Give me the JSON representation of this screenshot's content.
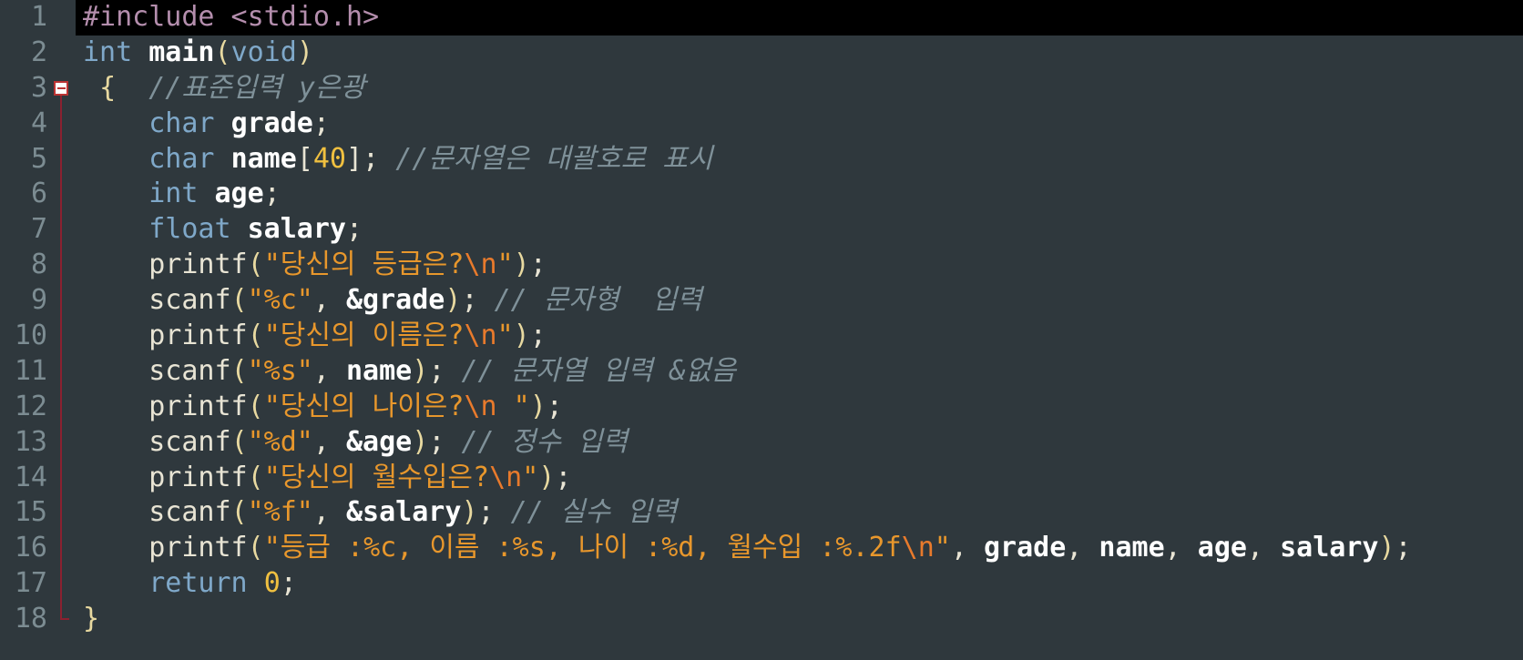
{
  "editor": {
    "language": "c",
    "theme": "dark",
    "background": "#2f383d",
    "gutter_background": "#2f383d",
    "current_line_background": "#000000",
    "line_number_color": "#7c8c92",
    "fold_marker_color": "#b33333",
    "total_lines": 18,
    "first_visible_line": 1,
    "fold_marker_line": 3,
    "fold_end_line": 18,
    "colors": {
      "preprocessor": "#b48ead",
      "keyword": "#7fa8c9",
      "identifier": "#ffffff",
      "string": "#e8972c",
      "escape": "#e87a2c",
      "number": "#f0c040",
      "comment": "#7f9199",
      "punctuation": "#e8e4d4",
      "brace": "#e8d9a0"
    }
  },
  "lines": [
    {
      "number": "1",
      "current": true,
      "tokens": [
        {
          "cls": "t-pre",
          "text": "#include <stdio.h>"
        }
      ]
    },
    {
      "number": "2",
      "current": false,
      "tokens": [
        {
          "cls": "t-key",
          "text": "int"
        },
        {
          "cls": "t-plain",
          "text": " "
        },
        {
          "cls": "t-ident",
          "text": "main"
        },
        {
          "cls": "t-paren",
          "text": "("
        },
        {
          "cls": "t-key",
          "text": "void"
        },
        {
          "cls": "t-paren",
          "text": ")"
        }
      ]
    },
    {
      "number": "3",
      "current": false,
      "tokens": [
        {
          "cls": "t-plain",
          "text": " "
        },
        {
          "cls": "t-brace",
          "text": "{"
        },
        {
          "cls": "t-plain",
          "text": "  "
        },
        {
          "cls": "t-com",
          "text": "//표준입력 y은광"
        }
      ]
    },
    {
      "number": "4",
      "current": false,
      "tokens": [
        {
          "cls": "t-plain",
          "text": "    "
        },
        {
          "cls": "t-key",
          "text": "char"
        },
        {
          "cls": "t-plain",
          "text": " "
        },
        {
          "cls": "t-ident",
          "text": "grade"
        },
        {
          "cls": "t-punc",
          "text": ";"
        }
      ]
    },
    {
      "number": "5",
      "current": false,
      "tokens": [
        {
          "cls": "t-plain",
          "text": "    "
        },
        {
          "cls": "t-key",
          "text": "char"
        },
        {
          "cls": "t-plain",
          "text": " "
        },
        {
          "cls": "t-ident",
          "text": "name"
        },
        {
          "cls": "t-punc",
          "text": "["
        },
        {
          "cls": "t-num",
          "text": "40"
        },
        {
          "cls": "t-punc",
          "text": "];"
        },
        {
          "cls": "t-plain",
          "text": " "
        },
        {
          "cls": "t-com",
          "text": "//문자열은 대괄호로 표시"
        }
      ]
    },
    {
      "number": "6",
      "current": false,
      "tokens": [
        {
          "cls": "t-plain",
          "text": "    "
        },
        {
          "cls": "t-key",
          "text": "int"
        },
        {
          "cls": "t-plain",
          "text": " "
        },
        {
          "cls": "t-ident",
          "text": "age"
        },
        {
          "cls": "t-punc",
          "text": ";"
        }
      ]
    },
    {
      "number": "7",
      "current": false,
      "tokens": [
        {
          "cls": "t-plain",
          "text": "    "
        },
        {
          "cls": "t-key",
          "text": "float"
        },
        {
          "cls": "t-plain",
          "text": " "
        },
        {
          "cls": "t-ident",
          "text": "salary"
        },
        {
          "cls": "t-punc",
          "text": ";"
        }
      ]
    },
    {
      "number": "8",
      "current": false,
      "tokens": [
        {
          "cls": "t-plain",
          "text": "    "
        },
        {
          "cls": "t-fn",
          "text": "printf"
        },
        {
          "cls": "t-paren",
          "text": "("
        },
        {
          "cls": "t-str",
          "text": "\"당신의 등급은?"
        },
        {
          "cls": "t-esc",
          "text": "\\n"
        },
        {
          "cls": "t-str",
          "text": "\""
        },
        {
          "cls": "t-paren",
          "text": ")"
        },
        {
          "cls": "t-punc",
          "text": ";"
        }
      ]
    },
    {
      "number": "9",
      "current": false,
      "tokens": [
        {
          "cls": "t-plain",
          "text": "    "
        },
        {
          "cls": "t-fn",
          "text": "scanf"
        },
        {
          "cls": "t-paren",
          "text": "("
        },
        {
          "cls": "t-str",
          "text": "\"%c\""
        },
        {
          "cls": "t-punc",
          "text": ", "
        },
        {
          "cls": "t-ident",
          "text": "&grade"
        },
        {
          "cls": "t-paren",
          "text": ")"
        },
        {
          "cls": "t-punc",
          "text": ";"
        },
        {
          "cls": "t-plain",
          "text": " "
        },
        {
          "cls": "t-com",
          "text": "// 문자형  입력"
        }
      ]
    },
    {
      "number": "10",
      "current": false,
      "tokens": [
        {
          "cls": "t-plain",
          "text": "    "
        },
        {
          "cls": "t-fn",
          "text": "printf"
        },
        {
          "cls": "t-paren",
          "text": "("
        },
        {
          "cls": "t-str",
          "text": "\"당신의 이름은?"
        },
        {
          "cls": "t-esc",
          "text": "\\n"
        },
        {
          "cls": "t-str",
          "text": "\""
        },
        {
          "cls": "t-paren",
          "text": ")"
        },
        {
          "cls": "t-punc",
          "text": ";"
        }
      ]
    },
    {
      "number": "11",
      "current": false,
      "tokens": [
        {
          "cls": "t-plain",
          "text": "    "
        },
        {
          "cls": "t-fn",
          "text": "scanf"
        },
        {
          "cls": "t-paren",
          "text": "("
        },
        {
          "cls": "t-str",
          "text": "\"%s\""
        },
        {
          "cls": "t-punc",
          "text": ", "
        },
        {
          "cls": "t-ident",
          "text": "name"
        },
        {
          "cls": "t-paren",
          "text": ")"
        },
        {
          "cls": "t-punc",
          "text": ";"
        },
        {
          "cls": "t-plain",
          "text": " "
        },
        {
          "cls": "t-com",
          "text": "// 문자열 입력 &없음"
        }
      ]
    },
    {
      "number": "12",
      "current": false,
      "tokens": [
        {
          "cls": "t-plain",
          "text": "    "
        },
        {
          "cls": "t-fn",
          "text": "printf"
        },
        {
          "cls": "t-paren",
          "text": "("
        },
        {
          "cls": "t-str",
          "text": "\"당신의 나이은?"
        },
        {
          "cls": "t-esc",
          "text": "\\n"
        },
        {
          "cls": "t-str",
          "text": " \""
        },
        {
          "cls": "t-paren",
          "text": ")"
        },
        {
          "cls": "t-punc",
          "text": ";"
        }
      ]
    },
    {
      "number": "13",
      "current": false,
      "tokens": [
        {
          "cls": "t-plain",
          "text": "    "
        },
        {
          "cls": "t-fn",
          "text": "scanf"
        },
        {
          "cls": "t-paren",
          "text": "("
        },
        {
          "cls": "t-str",
          "text": "\"%d\""
        },
        {
          "cls": "t-punc",
          "text": ", "
        },
        {
          "cls": "t-ident",
          "text": "&age"
        },
        {
          "cls": "t-paren",
          "text": ")"
        },
        {
          "cls": "t-punc",
          "text": ";"
        },
        {
          "cls": "t-plain",
          "text": " "
        },
        {
          "cls": "t-com",
          "text": "// 정수 입력"
        }
      ]
    },
    {
      "number": "14",
      "current": false,
      "tokens": [
        {
          "cls": "t-plain",
          "text": "    "
        },
        {
          "cls": "t-fn",
          "text": "printf"
        },
        {
          "cls": "t-paren",
          "text": "("
        },
        {
          "cls": "t-str",
          "text": "\"당신의 월수입은?"
        },
        {
          "cls": "t-esc",
          "text": "\\n"
        },
        {
          "cls": "t-str",
          "text": "\""
        },
        {
          "cls": "t-paren",
          "text": ")"
        },
        {
          "cls": "t-punc",
          "text": ";"
        }
      ]
    },
    {
      "number": "15",
      "current": false,
      "tokens": [
        {
          "cls": "t-plain",
          "text": "    "
        },
        {
          "cls": "t-fn",
          "text": "scanf"
        },
        {
          "cls": "t-paren",
          "text": "("
        },
        {
          "cls": "t-str",
          "text": "\"%f\""
        },
        {
          "cls": "t-punc",
          "text": ", "
        },
        {
          "cls": "t-ident",
          "text": "&salary"
        },
        {
          "cls": "t-paren",
          "text": ")"
        },
        {
          "cls": "t-punc",
          "text": ";"
        },
        {
          "cls": "t-plain",
          "text": " "
        },
        {
          "cls": "t-com",
          "text": "// 실수 입력"
        }
      ]
    },
    {
      "number": "16",
      "current": false,
      "tokens": [
        {
          "cls": "t-plain",
          "text": "    "
        },
        {
          "cls": "t-fn",
          "text": "printf"
        },
        {
          "cls": "t-paren",
          "text": "("
        },
        {
          "cls": "t-str",
          "text": "\"등급 :%c, 이름 :%s, 나이 :%d, 월수입 :%.2f"
        },
        {
          "cls": "t-esc",
          "text": "\\n"
        },
        {
          "cls": "t-str",
          "text": "\""
        },
        {
          "cls": "t-punc",
          "text": ", "
        },
        {
          "cls": "t-ident",
          "text": "grade"
        },
        {
          "cls": "t-punc",
          "text": ", "
        },
        {
          "cls": "t-ident",
          "text": "name"
        },
        {
          "cls": "t-punc",
          "text": ", "
        },
        {
          "cls": "t-ident",
          "text": "age"
        },
        {
          "cls": "t-punc",
          "text": ", "
        },
        {
          "cls": "t-ident",
          "text": "salary"
        },
        {
          "cls": "t-paren",
          "text": ")"
        },
        {
          "cls": "t-punc",
          "text": ";"
        }
      ]
    },
    {
      "number": "17",
      "current": false,
      "tokens": [
        {
          "cls": "t-plain",
          "text": "    "
        },
        {
          "cls": "t-key",
          "text": "return"
        },
        {
          "cls": "t-plain",
          "text": " "
        },
        {
          "cls": "t-num",
          "text": "0"
        },
        {
          "cls": "t-punc",
          "text": ";"
        }
      ]
    },
    {
      "number": "18",
      "current": false,
      "tokens": [
        {
          "cls": "t-brace",
          "text": "}"
        }
      ]
    }
  ]
}
